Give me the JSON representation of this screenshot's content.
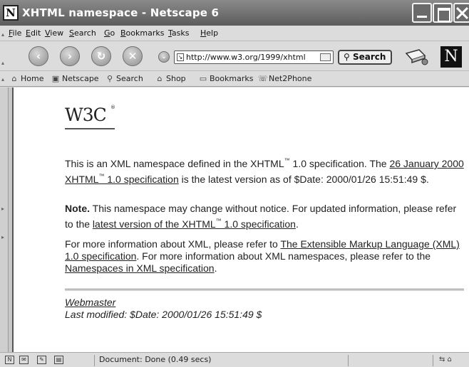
{
  "window": {
    "title": "XHTML namespace - Netscape 6",
    "logo_letter": "N"
  },
  "menubar": {
    "items": [
      {
        "first": "F",
        "rest": "ile"
      },
      {
        "first": "E",
        "rest": "dit"
      },
      {
        "first": "V",
        "rest": "iew"
      },
      {
        "first": "S",
        "rest": "earch"
      },
      {
        "first": "G",
        "rest": "o"
      },
      {
        "first": "B",
        "rest": "ookmarks"
      },
      {
        "first": "T",
        "rest": "asks"
      },
      {
        "first": "H",
        "rest": "elp"
      }
    ]
  },
  "navbar": {
    "url": "http://www.w3.org/1999/xhtml",
    "search_label": "Search",
    "brand_letter": "N"
  },
  "personal_toolbar": {
    "items": [
      "Home",
      "Netscape",
      "Search",
      "Shop",
      "Bookmarks",
      "Net2Phone"
    ]
  },
  "content": {
    "logo_text": "W3C",
    "logo_reg": "®",
    "p1": {
      "t1": "This is an XML namespace defined in the XHTML",
      "tm": "™",
      "t2": " 1.0 specification. The ",
      "link": "26 January 2000 XHTML",
      "link_tm": "™",
      "link2": " 1.0 specification",
      "t3": " is the latest version as of $Date: 2000/01/26 15:51:49 $."
    },
    "p2": {
      "bold": "Note.",
      "t1": " This namespace may change without notice. For updated information, please refer to the ",
      "link": "latest version of the XHTML",
      "link_tm": "™",
      "link2": " 1.0 specification",
      "t2": "."
    },
    "p3": {
      "t1": "For more information about XML, please refer to ",
      "link1": "The Extensible Markup Language (XML) 1.0 specification",
      "t2": ". For more information about XML namespaces, please refer to the ",
      "link2": "Namespaces in XML specification",
      "t3": "."
    },
    "footer": {
      "webmaster": "Webmaster",
      "modified": "Last modified: $Date: 2000/01/26 15:51:49 $"
    }
  },
  "statusbar": {
    "text": "Document: Done (0.49 secs)"
  }
}
